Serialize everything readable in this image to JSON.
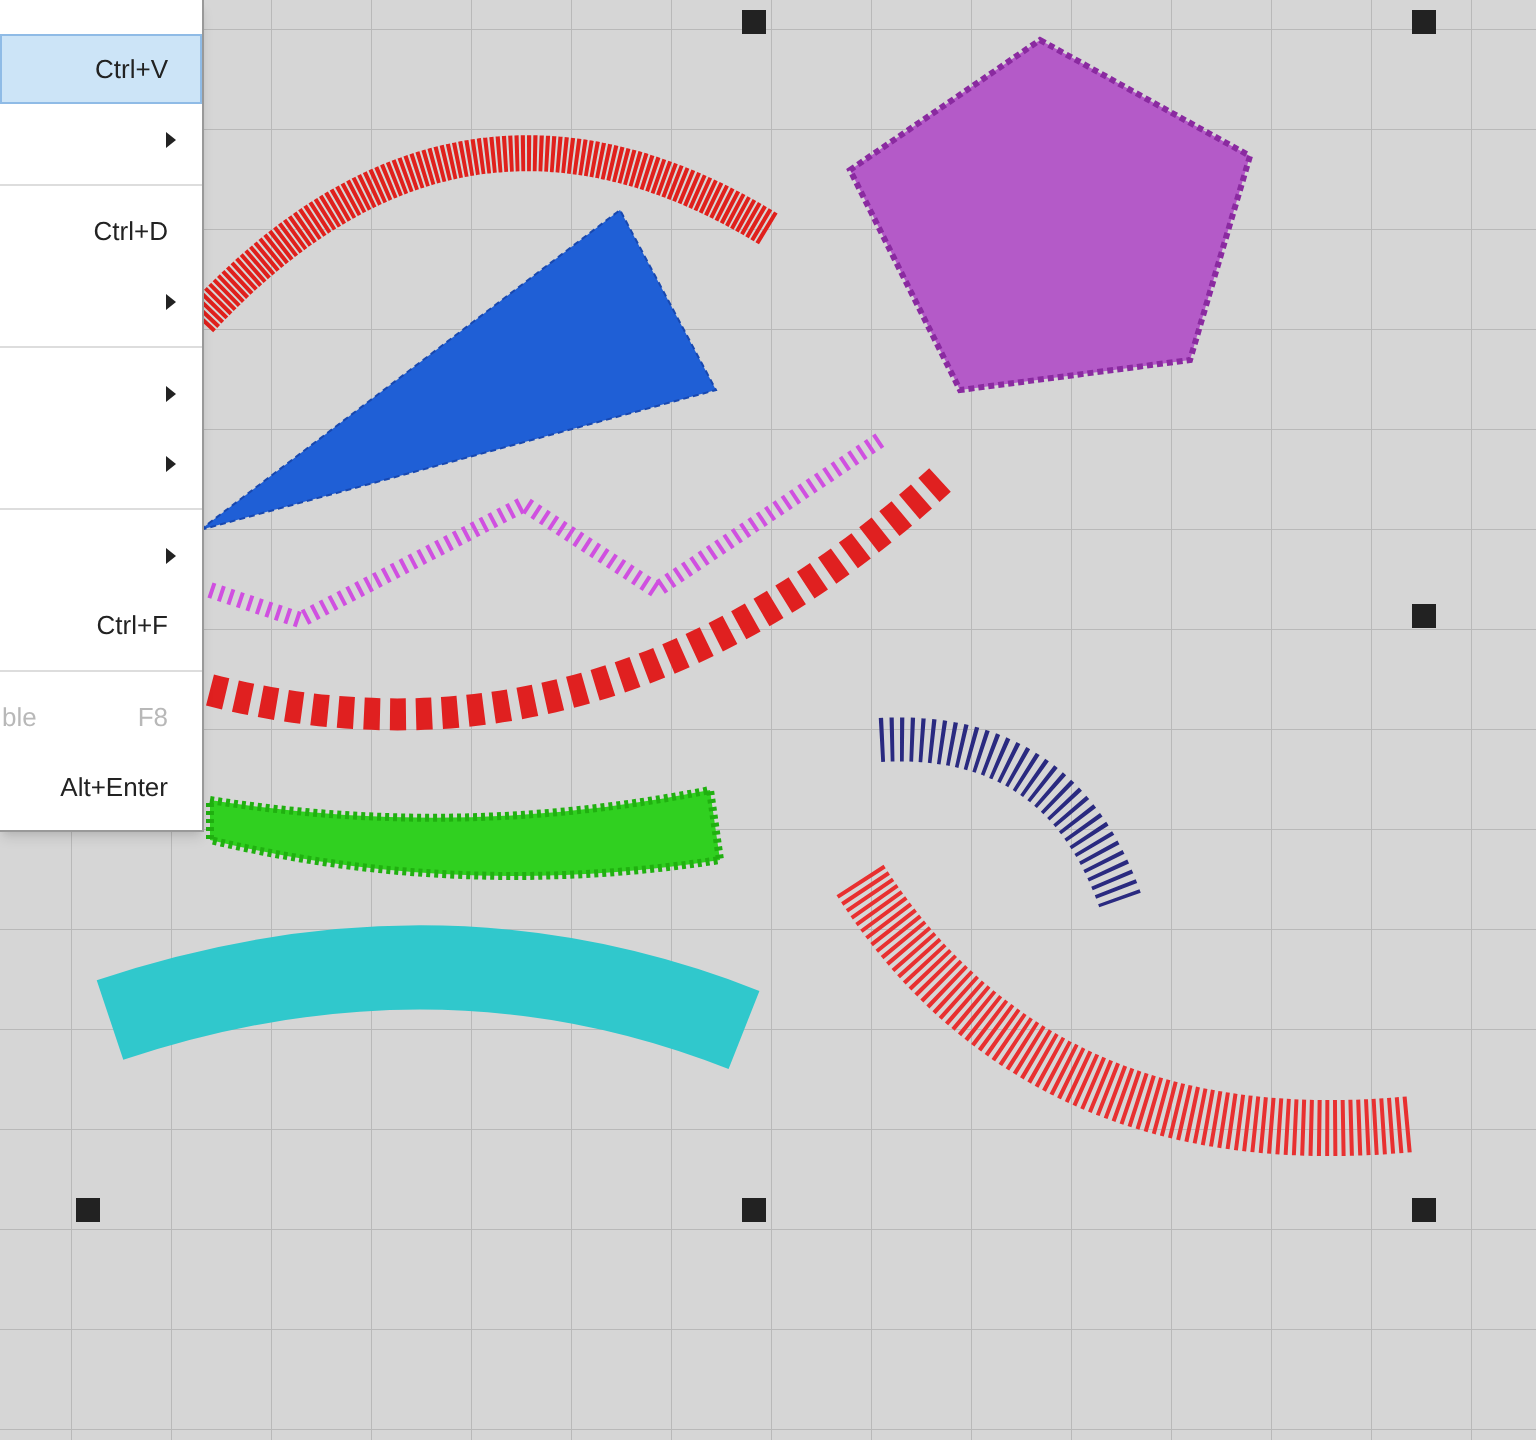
{
  "context_menu": {
    "items": [
      {
        "kind": "item",
        "shortcut": "Ctrl+V",
        "selected": true,
        "disabled": false,
        "submenu": false
      },
      {
        "kind": "item",
        "selected": false,
        "disabled": false,
        "submenu": true
      },
      {
        "kind": "separator"
      },
      {
        "kind": "item",
        "shortcut": "Ctrl+D",
        "selected": false,
        "disabled": false,
        "submenu": false
      },
      {
        "kind": "item",
        "selected": false,
        "disabled": false,
        "submenu": true
      },
      {
        "kind": "separator"
      },
      {
        "kind": "item",
        "selected": false,
        "disabled": false,
        "submenu": true
      },
      {
        "kind": "item",
        "selected": false,
        "disabled": false,
        "submenu": true
      },
      {
        "kind": "separator"
      },
      {
        "kind": "item",
        "selected": false,
        "disabled": false,
        "submenu": true
      },
      {
        "kind": "item",
        "shortcut": "Ctrl+F",
        "selected": false,
        "disabled": false,
        "submenu": false
      },
      {
        "kind": "separator"
      },
      {
        "kind": "item",
        "label": "ble",
        "shortcut": "F8",
        "selected": false,
        "disabled": true,
        "submenu": false
      },
      {
        "kind": "item",
        "shortcut": "Alt+Enter",
        "selected": false,
        "disabled": false,
        "submenu": false
      }
    ]
  }
}
